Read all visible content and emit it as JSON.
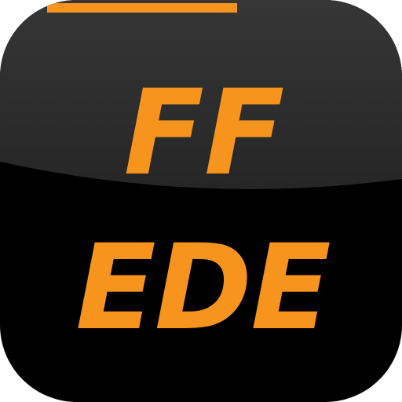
{
  "app_icon": {
    "line1": "FF",
    "line2": "EDE"
  },
  "colors": {
    "accent": "#F7941D",
    "background_dark": "#000000",
    "background_top": "#2B2B2B",
    "page": "#FFFFFF"
  }
}
